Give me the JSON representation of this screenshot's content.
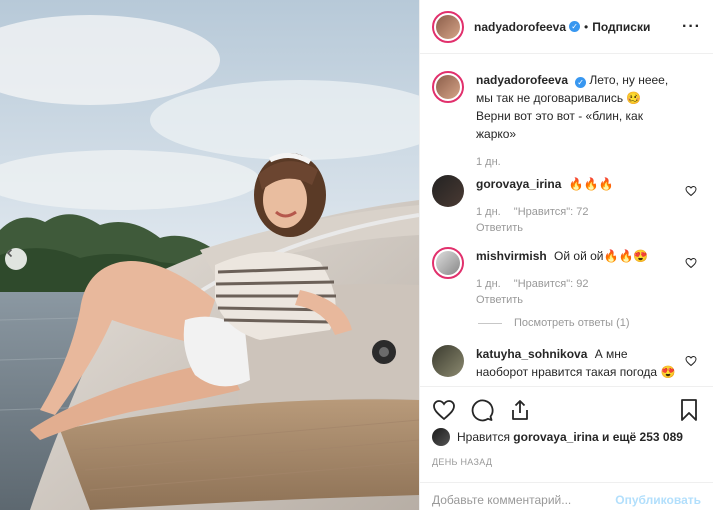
{
  "post": {
    "username": "nadyadorofeeva",
    "verified": true,
    "separator": "•",
    "follow_label": "Подписки",
    "caption": "Лето, ну неее, мы так не договаривались 🥴 Верни вот это вот - «блин, как жарко»",
    "caption_age": "1 дн."
  },
  "comments": [
    {
      "username": "gorovaya_irina",
      "text": "🔥🔥🔥",
      "age": "1 дн.",
      "likes": "\"Нравится\": 72",
      "reply": "Ответить"
    },
    {
      "username": "mishvirmish",
      "text": "Ой ой ой🔥🔥😍",
      "age": "1 дн.",
      "likes": "\"Нравится\": 92",
      "reply": "Ответить",
      "view_replies": "Посмотреть ответы (1)"
    },
    {
      "username": "katuyha_sohnikova",
      "text": "А мне наоборот нравится такая погода 😍 урожай так и растет,"
    }
  ],
  "likes_summary": {
    "prefix": "Нравится",
    "user": "gorovaya_irina",
    "suffix": "и ещё 253 089"
  },
  "date_label": "ДЕНЬ НАЗАД",
  "add_comment": {
    "placeholder": "Добавьте комментарий...",
    "post_label": "Опубликовать"
  },
  "icons": {
    "like": "heart-icon",
    "comment": "comment-icon",
    "share": "share-icon",
    "save": "bookmark-icon",
    "more": "more-options-icon",
    "prev": "chevron-left-icon"
  },
  "colors": {
    "accent": "#3897f0",
    "post_disabled": "#b2dffc",
    "meta": "#999999"
  }
}
